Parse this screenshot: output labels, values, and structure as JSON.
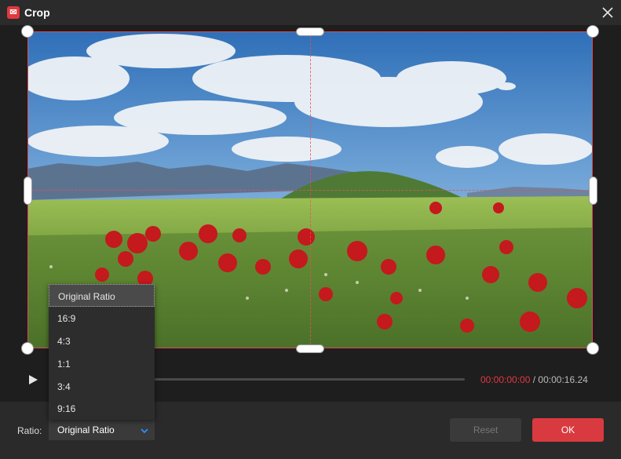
{
  "window": {
    "title": "Crop",
    "app_icon_glyph": "✉"
  },
  "icons": {
    "app": "app-logo-icon",
    "close": "close-icon",
    "play": "play-icon",
    "chevron": "chevron-down-icon"
  },
  "colors": {
    "accent": "#d93a3f",
    "crop_frame": "#e04a55",
    "time_current": "#e0393e",
    "chevron": "#2f8cff"
  },
  "player": {
    "current_time": "00:00:00:00",
    "separator": " / ",
    "total_time": "00:00:16.24",
    "progress": 0
  },
  "footer": {
    "ratio_label": "Ratio:",
    "ratio_value": "Original Ratio",
    "reset_label": "Reset",
    "ok_label": "OK"
  },
  "ratio_menu": {
    "selected_index": 0,
    "options": [
      "Original Ratio",
      "16:9",
      "4:3",
      "1:1",
      "3:4",
      "9:16"
    ]
  }
}
